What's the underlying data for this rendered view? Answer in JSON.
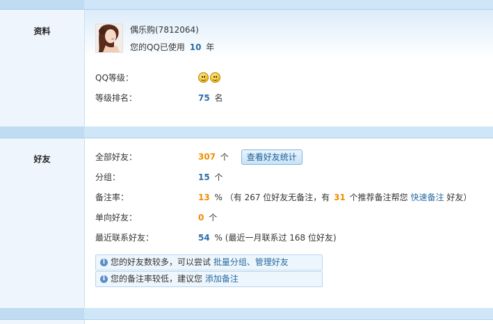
{
  "profile": {
    "section_label": "资料",
    "name": "偶乐购(7812064)",
    "years_prefix": "您的QQ已使用",
    "years": "10",
    "years_suffix": "年",
    "level_label": "QQ等级：",
    "level_icons": [
      "smiley-icon",
      "smiley-icon"
    ],
    "rank_label": "等级排名：",
    "rank_value": "75",
    "rank_unit": "名"
  },
  "friends": {
    "section_label": "好友",
    "total_label": "全部好友：",
    "total_value": "307",
    "total_unit": "个",
    "view_stats_button": "查看好友统计",
    "groups_label": "分组：",
    "groups_value": "15",
    "groups_unit": "个",
    "remark_rate_label": "备注率：",
    "remark_rate_value": "13",
    "remark_rate_unit": "%",
    "remark_detail_1": "（有 267 位好友无备注，有",
    "remark_recommend_value": "31",
    "remark_detail_2": "个推荐备注帮您",
    "quick_remark_link": "快速备注",
    "remark_detail_3": "好友）",
    "oneway_label": "单向好友：",
    "oneway_value": "0",
    "oneway_unit": "个",
    "recent_label": "最近联系好友：",
    "recent_value": "54",
    "recent_unit": "%",
    "recent_detail": "(最近一月联系过 168 位好友)",
    "tip1_text": "您的好友数较多，可以尝试",
    "tip1_link_group": "批量分组",
    "tip1_sep": "、",
    "tip1_link_manage": "管理好友",
    "tip2_text": "您的备注率较低，建议您",
    "tip2_link": "添加备注"
  },
  "colors": {
    "band": "#cfe6f8",
    "accent_orange": "#f08c00",
    "accent_blue": "#2c6ea5"
  }
}
